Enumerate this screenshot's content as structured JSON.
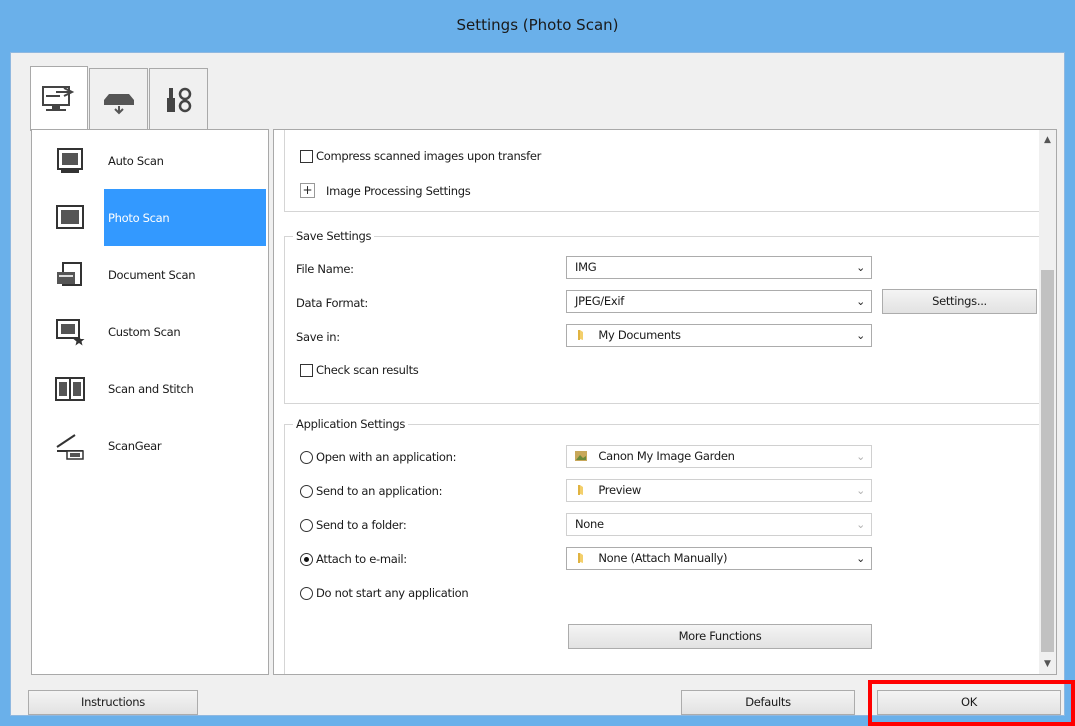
{
  "window": {
    "title": "Settings (Photo Scan)"
  },
  "tabs": [
    {
      "name": "scan-from-computer",
      "icon": "computer-scan-icon",
      "active": true
    },
    {
      "name": "scan-from-operation-panel",
      "icon": "scanner-icon",
      "active": false
    },
    {
      "name": "general-settings",
      "icon": "tools-icon",
      "active": false
    }
  ],
  "modes": [
    {
      "label": "Auto Scan",
      "icon": "auto-scan-icon"
    },
    {
      "label": "Photo Scan",
      "icon": "photo-scan-icon",
      "selected": true
    },
    {
      "label": "Document Scan",
      "icon": "document-scan-icon"
    },
    {
      "label": "Custom Scan",
      "icon": "custom-scan-icon"
    },
    {
      "label": "Scan and Stitch",
      "icon": "scan-and-stitch-icon"
    },
    {
      "label": "ScanGear",
      "icon": "scangear-icon"
    }
  ],
  "scan_options": {
    "compress_label": "Compress scanned images upon transfer",
    "compress_checked": false,
    "image_processing_label": "Image Processing Settings"
  },
  "save_settings": {
    "title": "Save Settings",
    "file_name_label": "File Name:",
    "file_name_value": "IMG",
    "data_format_label": "Data Format:",
    "data_format_value": "JPEG/Exif",
    "settings_button": "Settings...",
    "save_in_label": "Save in:",
    "save_in_value": "My Documents",
    "check_results_label": "Check scan results",
    "check_results_checked": false
  },
  "application_settings": {
    "title": "Application Settings",
    "options": [
      {
        "label": "Open with an application:",
        "value": "Canon My Image Garden",
        "checked": false,
        "icon": "image-garden-icon"
      },
      {
        "label": "Send to an application:",
        "value": "Preview",
        "checked": false,
        "icon": "folder-icon"
      },
      {
        "label": "Send to a folder:",
        "value": "None",
        "checked": false,
        "icon": ""
      },
      {
        "label": "Attach to e-mail:",
        "value": "None (Attach Manually)",
        "checked": true,
        "icon": "folder-icon"
      },
      {
        "label": "Do not start any application",
        "checked": false
      }
    ],
    "more_functions_button": "More Functions"
  },
  "footer": {
    "instructions_button": "Instructions",
    "defaults_button": "Defaults",
    "ok_button": "OK"
  },
  "colors": {
    "title_bar": "#6ab0ea",
    "selection": "#3399ff",
    "highlight_box": "#ff0000"
  }
}
